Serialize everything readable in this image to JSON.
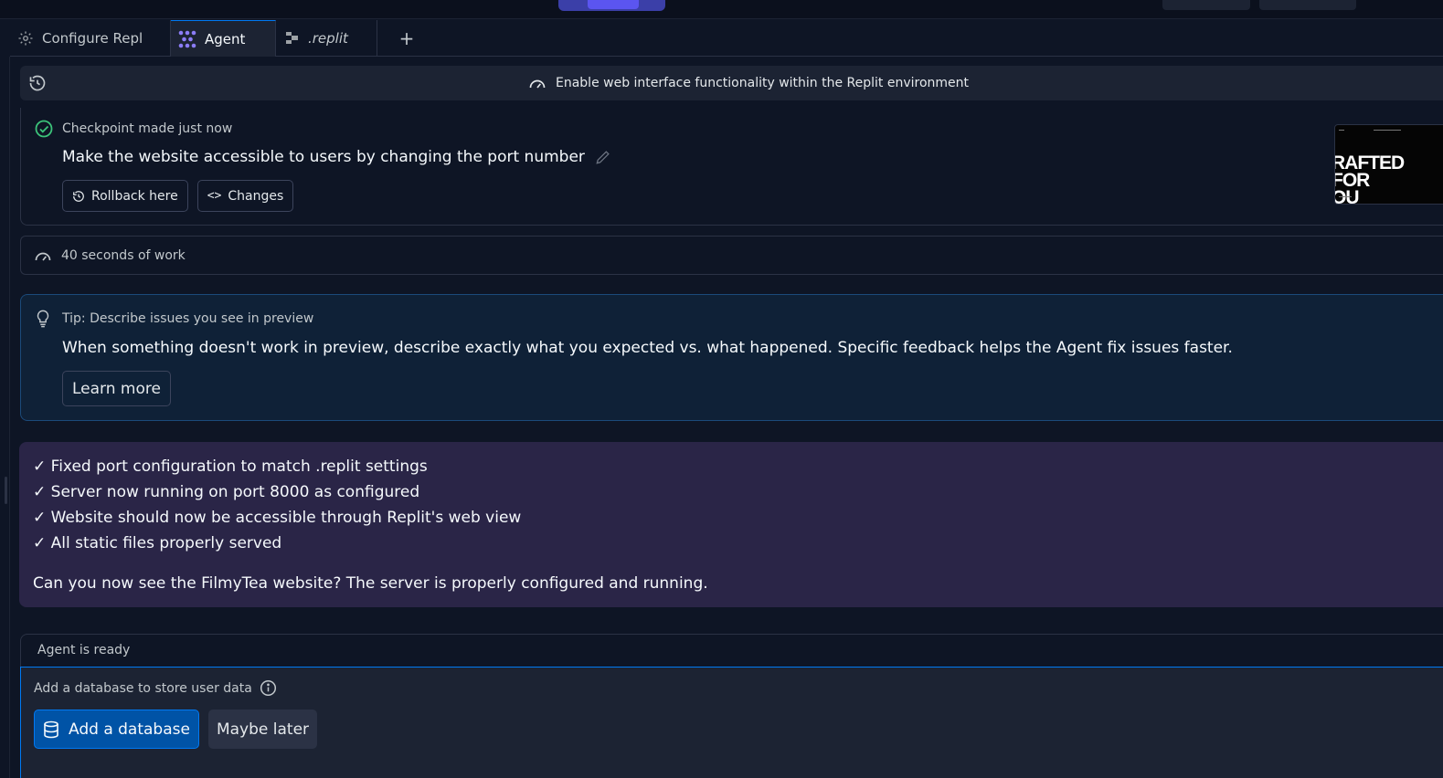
{
  "tabs": [
    {
      "label": "Configure Repl",
      "icon": "gear-icon"
    },
    {
      "label": "Agent",
      "icon": "agent-icon"
    },
    {
      "label": ".replit",
      "icon": "replit-file-icon"
    }
  ],
  "header": {
    "title": "Enable web interface functionality within the Replit environment"
  },
  "checkpoint": {
    "status": "Checkpoint made just now",
    "title": "Make the website accessible to users by changing the port number",
    "rollback_label": "Rollback here",
    "changes_label": "Changes",
    "thumbnail_text_line1": "RAFTED FOR",
    "thumbnail_text_line2": "OU"
  },
  "work": {
    "label": "40 seconds of work"
  },
  "tip": {
    "title": "Tip: Describe issues you see in preview",
    "body": "When something doesn't work in preview, describe exactly what you expected vs. what happened. Specific feedback helps the Agent fix issues faster.",
    "button": "Learn more"
  },
  "message": {
    "items": [
      "✓ Fixed port configuration to match .replit settings",
      "✓ Server now running on port 8000 as configured",
      "✓ Website should now be accessible through Replit's web view",
      "✓ All static files properly served"
    ],
    "question": "Can you now see the FilmyTea website? The server is properly configured and running."
  },
  "agent": {
    "status": "Agent is ready",
    "db_prompt": "Add a database to store user data",
    "add_db_label": "Add a database",
    "maybe_later_label": "Maybe later"
  },
  "colors": {
    "background": "#0e1525",
    "accent": "#0079f2",
    "agent_purple": "#8b7cf6",
    "success_green": "#3cc37a"
  }
}
